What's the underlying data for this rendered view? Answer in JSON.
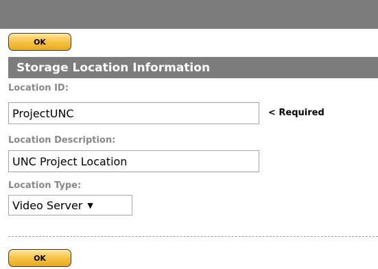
{
  "buttons": {
    "ok_top": "OK",
    "ok_bottom": "OK"
  },
  "section": {
    "title": "Storage Location Information"
  },
  "fields": {
    "location_id": {
      "label": "Location ID:",
      "value": "ProjectUNC",
      "note": "< Required"
    },
    "location_description": {
      "label": "Location Description:",
      "value": "UNC Project Location"
    },
    "location_type": {
      "label": "Location Type:",
      "value": "Video Server"
    }
  },
  "colors": {
    "bar": "#7d7d7d",
    "button": "#f7c64d",
    "label": "#888888"
  },
  "icons": {
    "dropdown": "triangle-down-icon"
  }
}
